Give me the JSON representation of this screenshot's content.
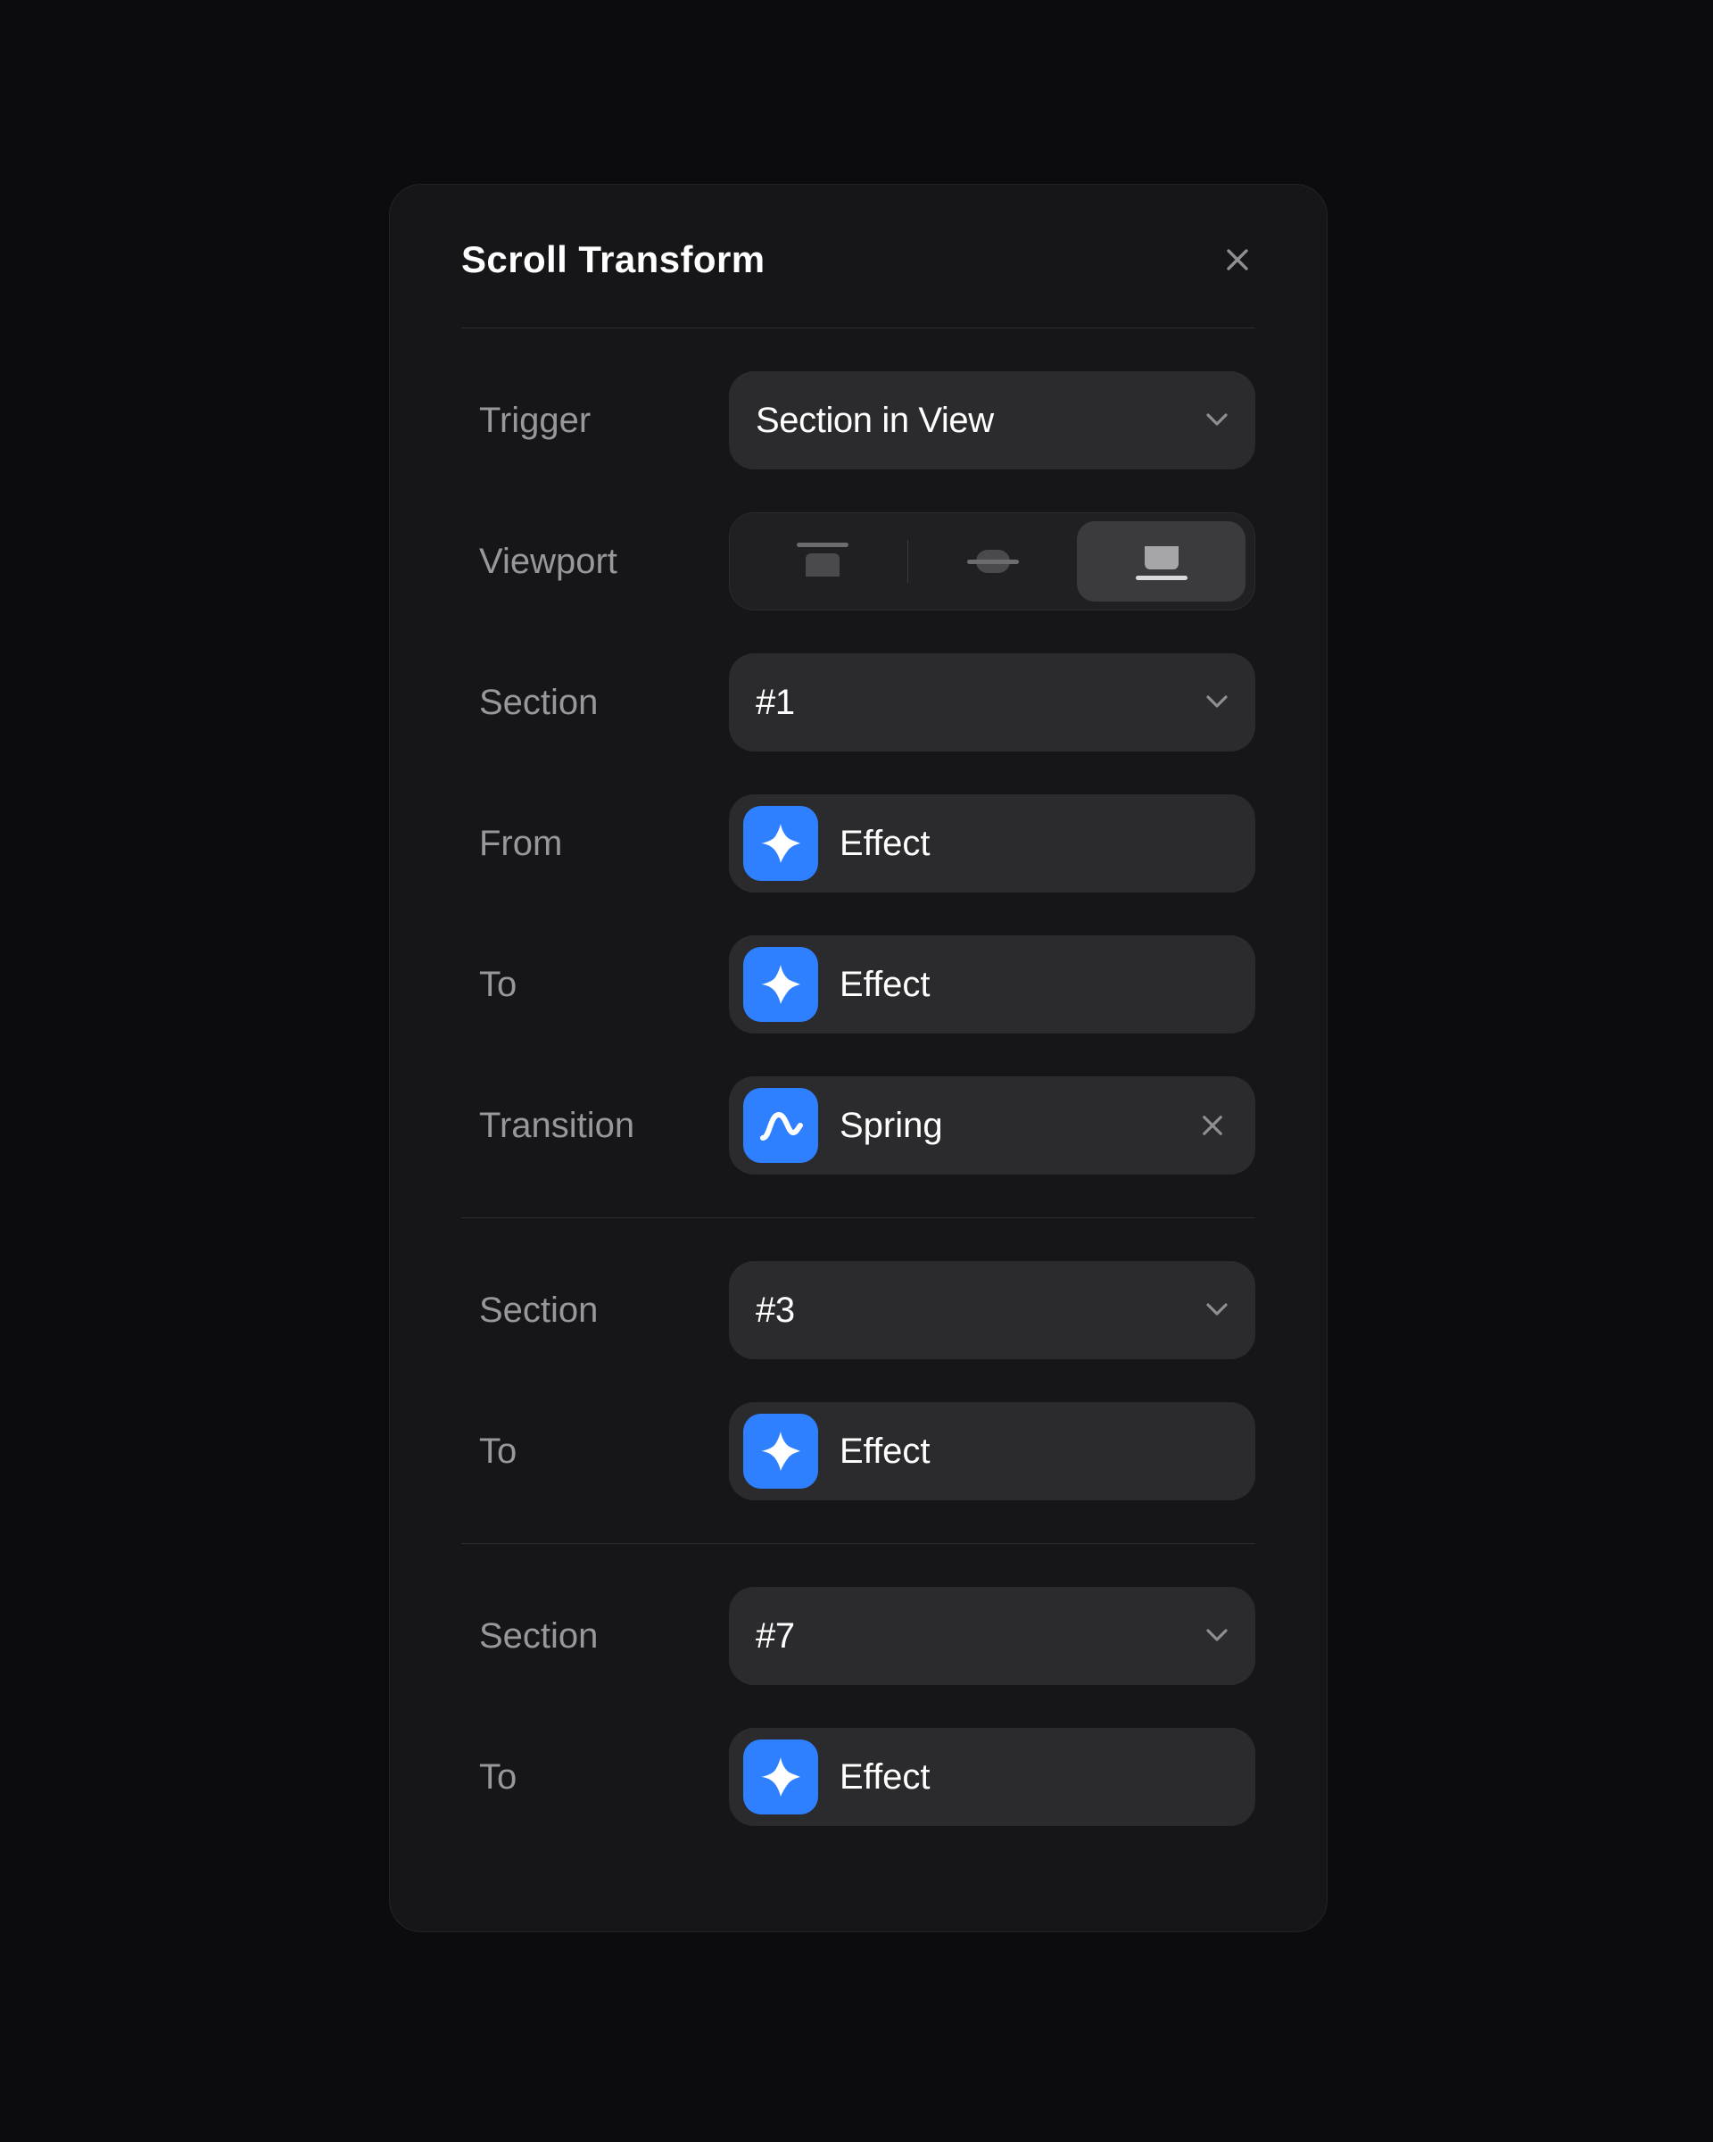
{
  "panel": {
    "title": "Scroll Transform"
  },
  "labels": {
    "trigger": "Trigger",
    "viewport": "Viewport",
    "section": "Section",
    "from": "From",
    "to": "To",
    "transition": "Transition"
  },
  "trigger": {
    "value": "Section in View"
  },
  "viewport": {
    "selected": "bottom"
  },
  "groups": [
    {
      "section": "#1",
      "from": "Effect",
      "to": "Effect",
      "transition": "Spring"
    },
    {
      "section": "#3",
      "to": "Effect"
    },
    {
      "section": "#7",
      "to": "Effect"
    }
  ],
  "colors": {
    "accent": "#2f80ff",
    "panel": "#161618",
    "background": "#0c0c0f"
  }
}
